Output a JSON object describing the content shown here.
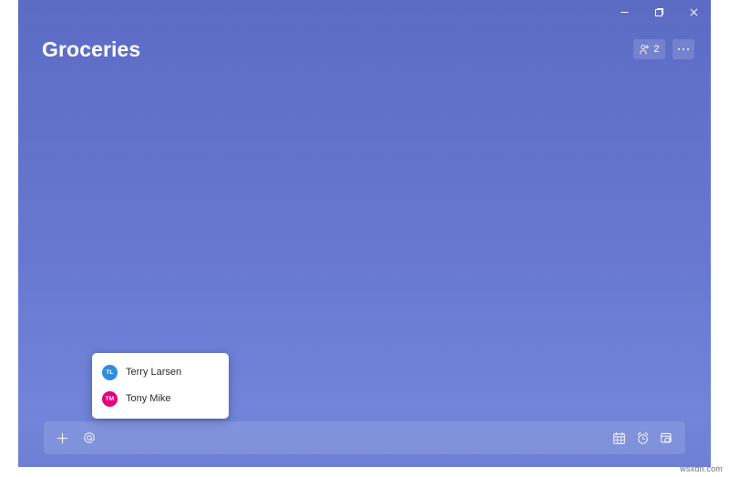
{
  "window": {
    "title": "Groceries",
    "controls": [
      {
        "name": "minimize",
        "label": "Minimize",
        "glyph": "minimize-icon"
      },
      {
        "name": "maximize",
        "label": "Restore",
        "glyph": "maximize-icon"
      },
      {
        "name": "close",
        "label": "Close",
        "glyph": "close-icon"
      }
    ]
  },
  "header": {
    "title": "Groceries",
    "share": {
      "icon": "person-add-icon",
      "count": "2",
      "label": "Share list"
    },
    "more": {
      "icon": "ellipsis-icon",
      "label": "See list options"
    }
  },
  "mention_popup": {
    "visible": true,
    "people": [
      {
        "initials": "TL",
        "name": "Terry Larsen",
        "avatar_color": "#2d8ce0"
      },
      {
        "initials": "TM",
        "name": "Tony Mike",
        "avatar_color": "#e6007e"
      }
    ]
  },
  "add_task_bar": {
    "add_icon": "plus-icon",
    "add_label": "Add a task",
    "mention_icon": "at-mention-icon",
    "mention_label": "Assign to",
    "input_value": "",
    "input_placeholder": "",
    "actions": [
      {
        "icon": "calendar-icon",
        "label": "Add due date"
      },
      {
        "icon": "alarm-clock-icon",
        "label": "Remind me"
      },
      {
        "icon": "repeat-icon",
        "label": "Repeat"
      }
    ]
  },
  "watermark": {
    "text": "wsxdn.com"
  },
  "colors": {
    "app_background_top": "#5c6cc4",
    "app_background_bottom": "#6d80d4",
    "avatar_blue": "#2d8ce0",
    "avatar_pink": "#e6007e",
    "text_on_accent": "#ffffff",
    "popup_background": "#ffffff"
  }
}
